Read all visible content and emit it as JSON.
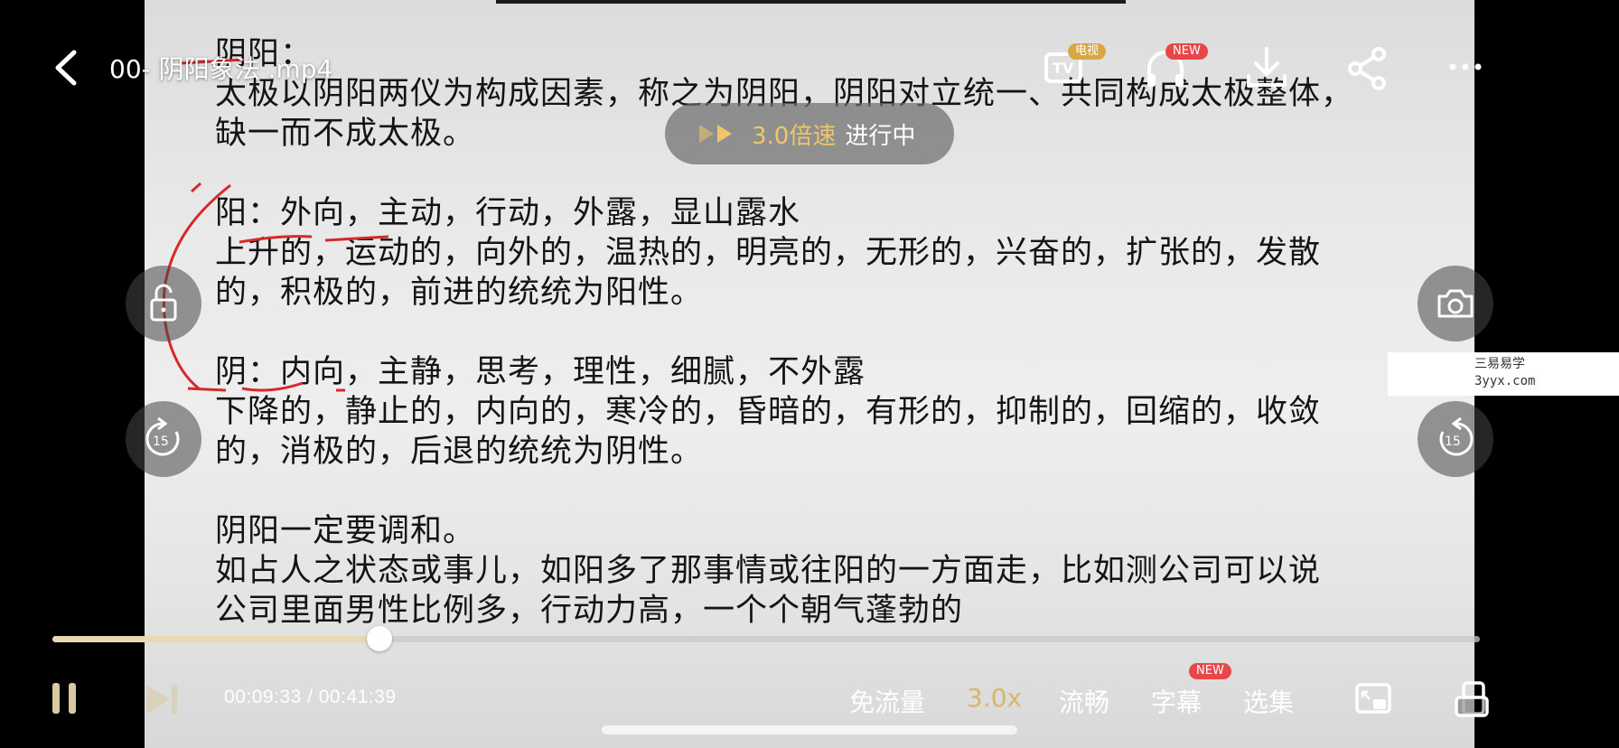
{
  "player": {
    "title": "00- 阴阳象法 .mp4",
    "current_time": "00:09:33",
    "total_time": "00:41:39",
    "time_display": "00:09:33 / 00:41:39",
    "progress_fraction": 0.2293,
    "speed_toast": {
      "value": "3.0倍速",
      "status": "进行中"
    },
    "badges": {
      "tv": "电视",
      "new_listen": "NEW",
      "new_subtitle": "NEW"
    },
    "bottom_menu": {
      "data_free": "免流量",
      "speed": "3.0x",
      "quality": "流畅",
      "subtitles": "字幕",
      "episodes": "选集"
    },
    "side_buttons": {
      "rewind_seconds": "15",
      "forward_seconds": "15"
    },
    "colors": {
      "accent_gold": "#f0c66a",
      "badge_red": "#e8474a",
      "badge_gold": "#d8a642",
      "progress_fill": "#e9d9b2"
    }
  },
  "slide": {
    "lines": [
      "阴阳：",
      "太极以阴阳两仪为构成因素，称之为阴阳，阴阳对立统一、共同构成太极整体，",
      "缺一而不成太极。",
      "",
      "阳：外向，主动，行动，外露，显山露水",
      "上升的，运动的，向外的，温热的，明亮的，无形的，兴奋的，扩张的，发散",
      "的，积极的，前进的统统为阳性。",
      "",
      "阴：内向，主静，思考，理性，细腻，不外露",
      "下降的，静止的，内向的，寒冷的，昏暗的，有形的，抑制的，回缩的，收敛",
      "的，消极的，后退的统统为阴性。",
      "",
      "阴阳一定要调和。",
      "如占人之状态或事儿，如阳多了那事情或往阳的一方面走，比如测公司可以说",
      "公司里面男性比例多，行动力高，一个个朝气蓬勃的"
    ]
  },
  "watermark": {
    "line1": "三易易学",
    "line2": "3yyx.com"
  }
}
